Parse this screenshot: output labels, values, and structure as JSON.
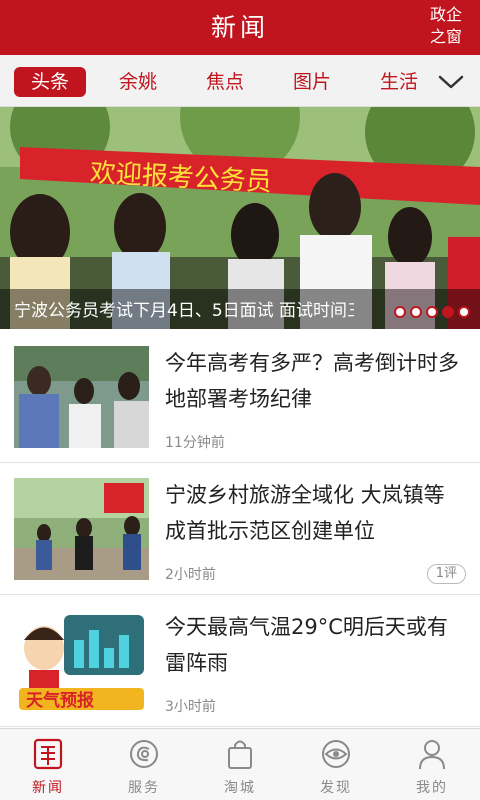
{
  "colors": {
    "brand": "#c0151e",
    "tab_bg": "#f2f2f2",
    "muted": "#8a8a8a"
  },
  "header": {
    "title": "新闻",
    "right_link": "政企之窗",
    "right_link_line1": "政企",
    "right_link_line2": "之窗"
  },
  "tabs": {
    "items": [
      {
        "label": "头条",
        "active": true
      },
      {
        "label": "余姚",
        "active": false
      },
      {
        "label": "焦点",
        "active": false
      },
      {
        "label": "图片",
        "active": false
      },
      {
        "label": "生活",
        "active": false
      }
    ],
    "expand_icon": "chevron-down-icon"
  },
  "banner": {
    "caption": "宁波公务员考试下月4日、5日面试 面试时间三",
    "image_banner_text": "欢迎报考公务员",
    "slides_total": 5,
    "active_slide": 4
  },
  "news": [
    {
      "title": "今年高考有多严？高考倒计时多地部署考场纪律",
      "time": "11分钟前",
      "comments": ""
    },
    {
      "title": "宁波乡村旅游全域化 大岚镇等成首批示范区创建单位",
      "time": "2小时前",
      "comments": "1评"
    },
    {
      "title": "今天最高气温29°C明后天或有雷阵雨",
      "time": "3小时前",
      "comments": "",
      "thumb_text": "天气预报"
    }
  ],
  "bottom_nav": [
    {
      "label": "新闻",
      "icon": "newspaper-icon",
      "active": true
    },
    {
      "label": "服务",
      "icon": "service-icon",
      "active": false
    },
    {
      "label": "淘城",
      "icon": "shopping-bag-icon",
      "active": false
    },
    {
      "label": "发现",
      "icon": "eye-icon",
      "active": false
    },
    {
      "label": "我的",
      "icon": "user-icon",
      "active": false
    }
  ]
}
